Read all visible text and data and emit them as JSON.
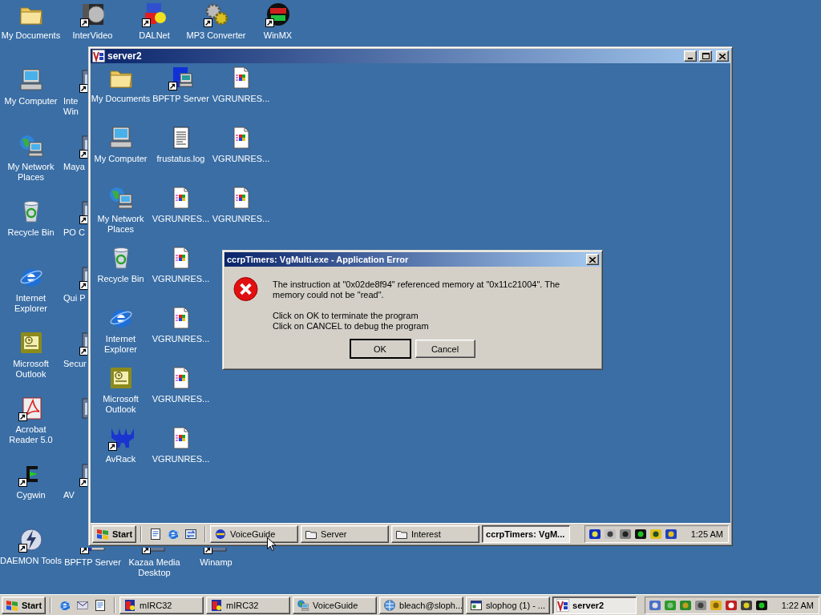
{
  "desktop": {
    "icons": [
      {
        "label": "My Documents",
        "kind": "folder",
        "shortcut": false
      },
      {
        "label": "My Computer",
        "kind": "computer",
        "shortcut": false
      },
      {
        "label": "My Network Places",
        "kind": "network",
        "shortcut": false
      },
      {
        "label": "Recycle Bin",
        "kind": "recycle",
        "shortcut": false
      },
      {
        "label": "Internet Explorer",
        "kind": "browser",
        "shortcut": false
      },
      {
        "label": "Microsoft Outlook",
        "kind": "mail",
        "shortcut": false
      },
      {
        "label": "Acrobat Reader 5.0",
        "kind": "acrobat",
        "shortcut": true
      },
      {
        "label": "Cygwin",
        "kind": "cygwin",
        "shortcut": true
      },
      {
        "label": "DAEMON Tools",
        "kind": "daemon",
        "shortcut": true
      },
      {
        "label": "InterVideo",
        "kind": "media",
        "shortcut": true
      },
      {
        "label": "Inte Win",
        "kind": "app",
        "shortcut": true
      },
      {
        "label": "Maya",
        "kind": "app",
        "shortcut": true
      },
      {
        "label": "PO C",
        "kind": "app",
        "shortcut": true
      },
      {
        "label": "Qui P",
        "kind": "app",
        "shortcut": true
      },
      {
        "label": "Secur",
        "kind": "app",
        "shortcut": true
      },
      {
        "kind": "app",
        "shortcut": false
      },
      {
        "label": "AV",
        "kind": "app",
        "shortcut": true
      },
      {
        "label": "BPFTP Server",
        "kind": "server",
        "shortcut": true
      },
      {
        "label": "DALNet",
        "kind": "chat",
        "shortcut": true
      },
      {
        "label": "Kazaa Media Desktop",
        "kind": "app",
        "shortcut": true
      },
      {
        "label": "MP3 Converter",
        "kind": "gears",
        "shortcut": true
      },
      {
        "label": "Winamp",
        "kind": "app",
        "shortcut": true
      },
      {
        "label": "WinMX",
        "kind": "badge",
        "shortcut": true
      }
    ]
  },
  "window": {
    "title": "server2",
    "desktop": {
      "icons": [
        {
          "label": "My Documents",
          "kind": "folder",
          "shortcut": false
        },
        {
          "label": "My Computer",
          "kind": "computer",
          "shortcut": false
        },
        {
          "label": "My Network Places",
          "kind": "network",
          "shortcut": false
        },
        {
          "label": "Recycle Bin",
          "kind": "recycle",
          "shortcut": false
        },
        {
          "label": "Internet Explorer",
          "kind": "browser",
          "shortcut": false
        },
        {
          "label": "Microsoft Outlook",
          "kind": "mail",
          "shortcut": false
        },
        {
          "label": "AvRack",
          "kind": "avrack",
          "shortcut": true
        },
        {
          "label": "BPFTP Server",
          "kind": "server",
          "shortcut": true
        },
        {
          "label": "frustatus.log",
          "kind": "log",
          "shortcut": false
        },
        {
          "label": "VGRUNRES...",
          "kind": "file",
          "shortcut": false
        },
        {
          "label": "VGRUNRES...",
          "kind": "file",
          "shortcut": false
        },
        {
          "label": "VGRUNRES...",
          "kind": "file",
          "shortcut": false
        },
        {
          "label": "VGRUNRES...",
          "kind": "file",
          "shortcut": false
        },
        {
          "label": "VGRUNRES...",
          "kind": "file",
          "shortcut": false
        },
        {
          "label": "VGRUNRES...",
          "kind": "file",
          "shortcut": false
        },
        {
          "label": "VGRUNRES...",
          "kind": "file",
          "shortcut": false
        },
        {
          "label": "VGRUNRES...",
          "kind": "file",
          "shortcut": false
        }
      ]
    },
    "dialog": {
      "title": "ccrpTimers: VgMulti.exe - Application Error",
      "message": "The instruction at \"0x02de8f94\" referenced memory at \"0x11c21004\". The memory could not be \"read\".",
      "instructions": [
        "Click on OK to terminate the program",
        "Click on CANCEL to debug the program"
      ],
      "buttons": [
        {
          "label": "OK",
          "focused": true
        },
        {
          "label": "Cancel",
          "focused": false
        }
      ]
    },
    "taskbar": {
      "start": "Start",
      "tasks": [
        {
          "label": "VoiceGuide",
          "kind": "voice",
          "selected": false
        },
        {
          "label": "Server",
          "kind": "folder_outline",
          "selected": false
        },
        {
          "label": "Interest",
          "kind": "folder_outline",
          "selected": false
        },
        {
          "label": "ccrpTimers: VgM...",
          "kind": "none",
          "selected": true
        }
      ],
      "clock": "1:25 AM"
    }
  },
  "taskbar": {
    "start": "Start",
    "tasks": [
      {
        "label": "mIRC32",
        "kind": "irc",
        "selected": false
      },
      {
        "label": "mIRC32",
        "kind": "irc",
        "selected": false
      },
      {
        "label": "VoiceGuide",
        "kind": "network",
        "selected": false
      },
      {
        "label": "bleach@sloph...",
        "kind": "web",
        "selected": false
      },
      {
        "label": "slophog (1) - ...",
        "kind": "window",
        "selected": false
      },
      {
        "label": "server2",
        "kind": "vnc",
        "selected": true
      }
    ],
    "clock": "1:22 AM"
  }
}
